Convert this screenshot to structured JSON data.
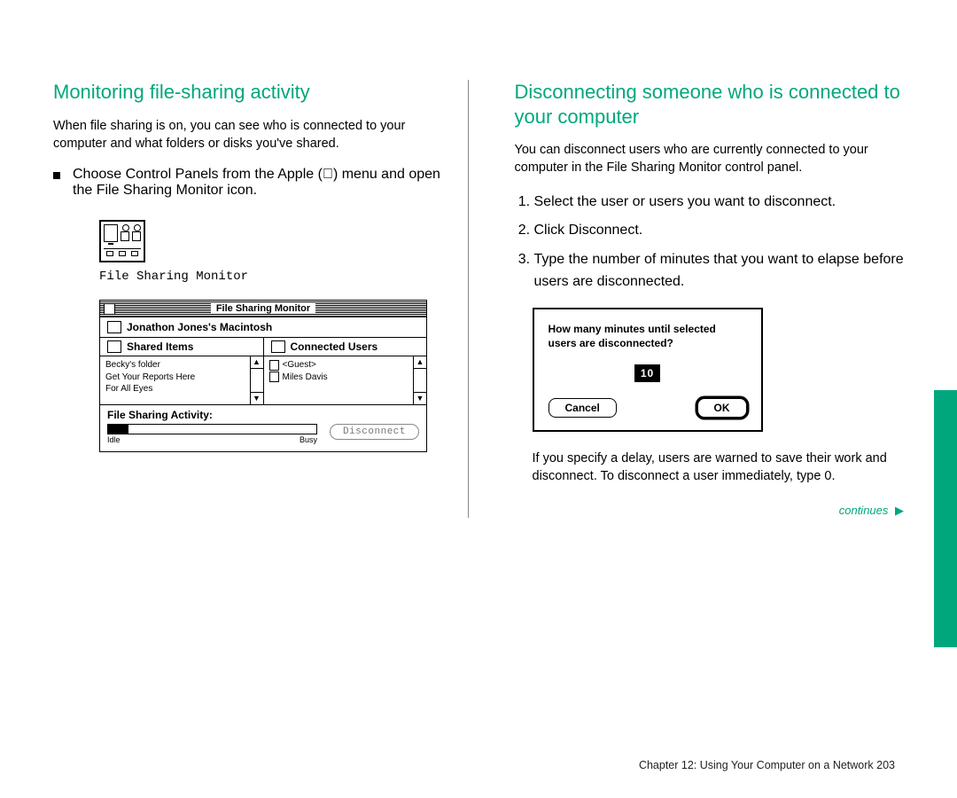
{
  "left": {
    "title": "Monitoring file-sharing activity",
    "intro": "When file sharing is on, you can see who is connected to your computer and what folders or disks you've shared.",
    "bullet": "Choose Control Panels from the Apple () menu and open the File Sharing Monitor icon.",
    "icon_caption": "File Sharing Monitor",
    "window": {
      "title": "File Sharing Monitor",
      "owner": "Jonathon Jones's Macintosh",
      "shared_header": "Shared Items",
      "connected_header": "Connected Users",
      "shared_items": [
        "Becky's folder",
        "Get Your Reports Here",
        "For All Eyes"
      ],
      "connected_users": [
        "<Guest>",
        "Miles Davis"
      ],
      "activity_label": "File Sharing Activity:",
      "scale_idle": "Idle",
      "scale_busy": "Busy",
      "disconnect_btn": "Disconnect"
    }
  },
  "right": {
    "title": "Disconnecting someone who is connected to your computer",
    "intro": "You can disconnect users who are currently connected to your computer in the File Sharing Monitor control panel.",
    "steps": [
      "Select the user or users you want to disconnect.",
      "Click Disconnect.",
      "Type the number of minutes that you want to elapse before users are disconnected."
    ],
    "dialog": {
      "prompt": "How many minutes until selected users are disconnected?",
      "value": "10",
      "cancel": "Cancel",
      "ok": "OK"
    },
    "note": "If you specify a delay, users are warned to save their work and disconnect. To disconnect a user immediately, type 0.",
    "continues": "continues"
  },
  "footer": "Chapter 12: Using Your Computer on a Network   203"
}
